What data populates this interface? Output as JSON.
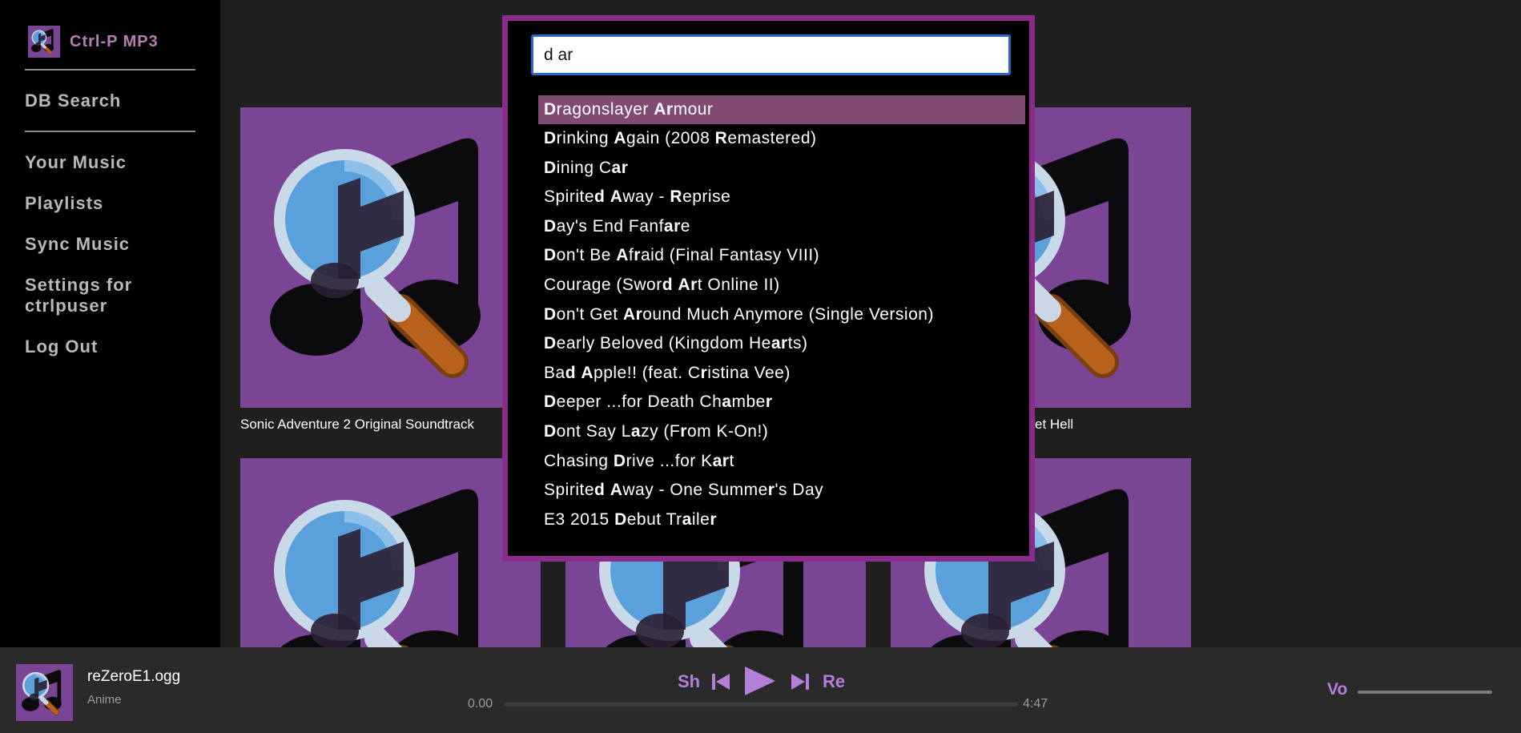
{
  "app": {
    "name": "Ctrl-P MP3"
  },
  "sidebar": {
    "db_search": "DB Search",
    "items": [
      {
        "label": "Your Music"
      },
      {
        "label": "Playlists"
      },
      {
        "label": "Sync Music"
      },
      {
        "label": "Settings for ctrlpuser"
      },
      {
        "label": "Log Out"
      }
    ]
  },
  "grid": {
    "cards": [
      {
        "title": "Sonic Adventure 2 Original Soundtrack"
      },
      {
        "title": ""
      },
      {
        "title": "et Hell"
      },
      {
        "title": ""
      },
      {
        "title": ""
      },
      {
        "title": ""
      }
    ]
  },
  "search": {
    "query": "d ar",
    "results": [
      [
        [
          "D",
          true
        ],
        [
          "ragonslayer ",
          false
        ],
        [
          "Ar",
          true
        ],
        [
          "mour",
          false
        ]
      ],
      [
        [
          "D",
          true
        ],
        [
          "rinking ",
          false
        ],
        [
          "A",
          true
        ],
        [
          "gain (2008 ",
          false
        ],
        [
          "R",
          true
        ],
        [
          "emastered)",
          false
        ]
      ],
      [
        [
          "D",
          true
        ],
        [
          "ining C",
          false
        ],
        [
          "ar",
          true
        ]
      ],
      [
        [
          "Spirite",
          false
        ],
        [
          "d",
          true
        ],
        [
          " ",
          false
        ],
        [
          "A",
          true
        ],
        [
          "way - ",
          false
        ],
        [
          "R",
          true
        ],
        [
          "eprise",
          false
        ]
      ],
      [
        [
          "D",
          true
        ],
        [
          "ay's End Fanf",
          false
        ],
        [
          "ar",
          true
        ],
        [
          "e",
          false
        ]
      ],
      [
        [
          "D",
          true
        ],
        [
          "on't Be ",
          false
        ],
        [
          "A",
          true
        ],
        [
          "f",
          false
        ],
        [
          "r",
          true
        ],
        [
          "aid (Final Fantasy VIII)",
          false
        ]
      ],
      [
        [
          "Courage (Swor",
          false
        ],
        [
          "d",
          true
        ],
        [
          " ",
          false
        ],
        [
          "Ar",
          true
        ],
        [
          "t Online II)",
          false
        ]
      ],
      [
        [
          "D",
          true
        ],
        [
          "on't Get ",
          false
        ],
        [
          "Ar",
          true
        ],
        [
          "ound Much Anymore (Single Version)",
          false
        ]
      ],
      [
        [
          "D",
          true
        ],
        [
          "early Beloved (Kingdom He",
          false
        ],
        [
          "ar",
          true
        ],
        [
          "ts)",
          false
        ]
      ],
      [
        [
          "Ba",
          false
        ],
        [
          "d",
          true
        ],
        [
          " ",
          false
        ],
        [
          "A",
          true
        ],
        [
          "pple!! (feat. C",
          false
        ],
        [
          "r",
          true
        ],
        [
          "istina Vee)",
          false
        ]
      ],
      [
        [
          "D",
          true
        ],
        [
          "eeper ...for Death Ch",
          false
        ],
        [
          "a",
          true
        ],
        [
          "mbe",
          false
        ],
        [
          "r",
          true
        ]
      ],
      [
        [
          "D",
          true
        ],
        [
          "ont Say L",
          false
        ],
        [
          "a",
          true
        ],
        [
          "zy (F",
          false
        ],
        [
          "r",
          true
        ],
        [
          "om K-On!)",
          false
        ]
      ],
      [
        [
          "Chasing ",
          false
        ],
        [
          "D",
          true
        ],
        [
          "rive ...for K",
          false
        ],
        [
          "ar",
          true
        ],
        [
          "t",
          false
        ]
      ],
      [
        [
          "Spirite",
          false
        ],
        [
          "d",
          true
        ],
        [
          " ",
          false
        ],
        [
          "A",
          true
        ],
        [
          "way - One Summe",
          false
        ],
        [
          "r",
          true
        ],
        [
          "'s Day",
          false
        ]
      ],
      [
        [
          "E3 2015 ",
          false
        ],
        [
          "D",
          true
        ],
        [
          "ebut Tr",
          false
        ],
        [
          "a",
          true
        ],
        [
          "ile",
          false
        ],
        [
          "r",
          true
        ]
      ]
    ]
  },
  "player": {
    "title": "reZeroE1.ogg",
    "album": "Anime",
    "shuffle_label": "Sh",
    "repeat_label": "Re",
    "volume_label": "Vo",
    "current_time": "0.00",
    "duration": "4:47",
    "progress": 0
  },
  "icons": {
    "logo": "magnifier-music-note-icon",
    "prev": "skip-back-icon",
    "play": "play-icon",
    "next": "skip-forward-icon"
  },
  "colors": {
    "accent": "#b47fd8",
    "brand": "#b47fb6",
    "art_bg": "#7b4595",
    "selected_row": "#814a71",
    "overlay_border": "#8b2c8c"
  }
}
